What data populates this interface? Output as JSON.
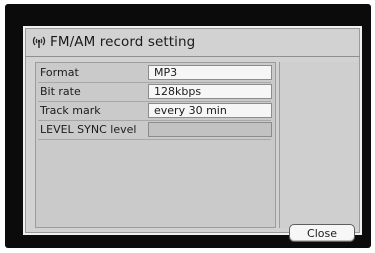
{
  "dialog": {
    "title": "FM/AM record setting",
    "title_icon": "antenna-icon",
    "close_label": "Close"
  },
  "settings": [
    {
      "label": "Format",
      "value": "MP3"
    },
    {
      "label": "Bit rate",
      "value": "128kbps"
    },
    {
      "label": "Track mark",
      "value": "every 30 min"
    },
    {
      "label": "LEVEL SYNC level",
      "value": ""
    }
  ]
}
